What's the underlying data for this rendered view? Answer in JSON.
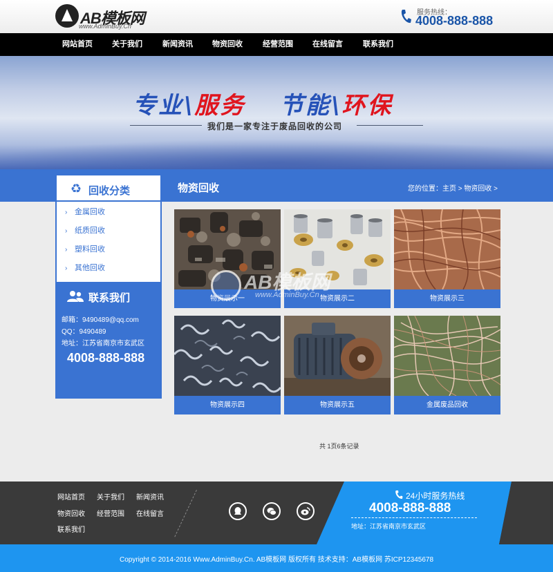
{
  "header": {
    "logo_text": "AB模板网",
    "logo_sub": "www.AdminBuy.Cn",
    "hotline_label": "服务热线：",
    "hotline_number": "4008-888-888"
  },
  "nav": {
    "items": [
      "网站首页",
      "关于我们",
      "新闻资讯",
      "物资回收",
      "经营范围",
      "在线留言",
      "联系我们"
    ]
  },
  "banner": {
    "slogan_part1": "专业\\",
    "slogan_part1_red": "服务",
    "slogan_part2": "节能\\",
    "slogan_part2_red": "环保",
    "subtitle": "我们是一家专注于废品回收的公司"
  },
  "main": {
    "section_title": "物资回收",
    "breadcrumb": "您的位置：主页 > 物资回收 >"
  },
  "sidebar": {
    "category_title": "回收分类",
    "categories": [
      "金属回收",
      "纸质回收",
      "塑料回收",
      "其他回收"
    ],
    "contact_title": "联系我们",
    "email": "邮箱：9490489@qq.com",
    "qq": "QQ：9490489",
    "address": "地址：江苏省南京市玄武区",
    "phone": "4008-888-888"
  },
  "products": [
    {
      "label": "物资展示一",
      "icon": "scrap-metal-image"
    },
    {
      "label": "物资展示二",
      "icon": "metal-parts-image"
    },
    {
      "label": "物资展示三",
      "icon": "copper-wire-image"
    },
    {
      "label": "物资展示四",
      "icon": "metal-shavings-image"
    },
    {
      "label": "物资展示五",
      "icon": "electric-motor-image"
    },
    {
      "label": "金属废品回收",
      "icon": "wire-scrap-image"
    }
  ],
  "pager": "共 1页6条记录",
  "watermark": {
    "text": "AB模板网",
    "sub": "www.AdminBuy.Cn"
  },
  "footer": {
    "links": [
      "网站首页",
      "关于我们",
      "新闻资讯",
      "物资回收",
      "经营范围",
      "在线留言",
      "联系我们"
    ],
    "hotline_label": "24小时服务热线",
    "hotline_number": "4008-888-888",
    "address": "地址：江苏省南京市玄武区",
    "copyright": "Copyright © 2014-2016 Www.AdminBuy.Cn. AB模板网 版权所有    技术支持：AB模板网    苏ICP12345678"
  },
  "colors": {
    "primary_blue": "#3a73d2",
    "footer_blue": "#1e95f0",
    "header_blue_text": "#1a55a8",
    "slogan_red": "#e0151e"
  }
}
